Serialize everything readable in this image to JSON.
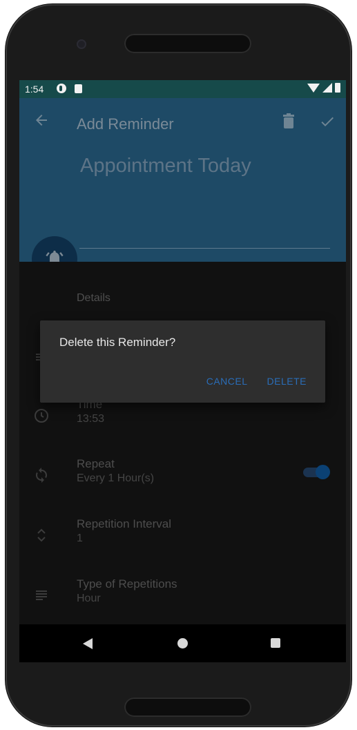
{
  "status_bar": {
    "time": "1:54"
  },
  "app_bar": {
    "title": "Add Reminder",
    "reminder_title": "Appointment Today"
  },
  "details_section": {
    "label": "Details"
  },
  "rows": [
    {
      "title": "Time",
      "value": "13:53",
      "icon": "clock-icon"
    },
    {
      "title": "Repeat",
      "value": "Every 1 Hour(s)",
      "icon": "repeat-icon",
      "toggle_on": true
    },
    {
      "title": "Repetition Interval",
      "value": "1",
      "icon": "unfold-icon"
    },
    {
      "title": "Type of Repetitions",
      "value": "Hour",
      "icon": "subject-icon"
    }
  ],
  "dialog": {
    "message": "Delete this Reminder?",
    "cancel_label": "CANCEL",
    "delete_label": "DELETE"
  },
  "colors": {
    "app_bar": "#1e4a66",
    "status_bar": "#164a4a",
    "accent": "#2a6db8",
    "dialog_bg": "#2e2e2e"
  }
}
